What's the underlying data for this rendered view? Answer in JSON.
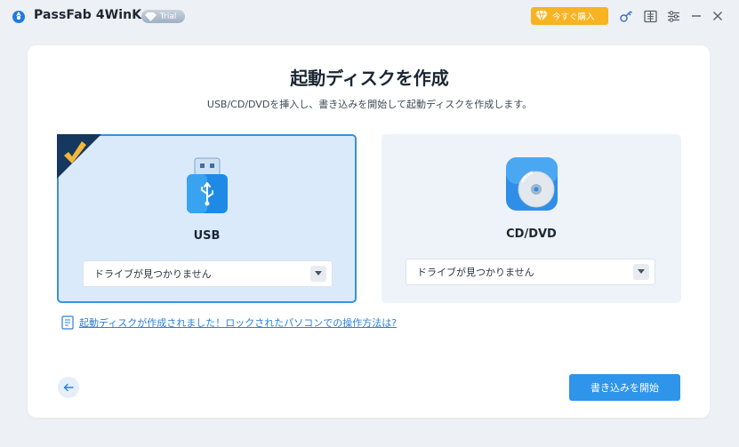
{
  "window": {
    "app_title": "PassFab 4WinKey",
    "trial_badge": "Trial",
    "buy_label": "今すぐ購入"
  },
  "main": {
    "title": "起動ディスクを作成",
    "subtitle": "USB/CD/DVDを挿入し、書き込みを開始して起動ディスクを作成します。",
    "options": [
      {
        "label": "USB",
        "dropdown_value": "ドライブが見つかりません",
        "selected": true
      },
      {
        "label": "CD/DVD",
        "dropdown_value": "ドライブが見つかりません",
        "selected": false
      }
    ],
    "help_link": "起動ディスクが作成されました！ロックされたパソコンでの操作方法は?",
    "start_button": "書き込みを開始"
  },
  "colors": {
    "accent": "#2e95ea",
    "selected_border": "#3b8fe0",
    "buy_button": "#f7b321",
    "link": "#2f7fd4"
  },
  "icons": [
    "app-logo-icon",
    "diamond-icon",
    "key-icon",
    "list-icon",
    "settings-icon",
    "minimize-icon",
    "close-icon",
    "usb-icon",
    "cd-dvd-icon",
    "checkmark-icon",
    "document-icon",
    "back-arrow-icon",
    "chevron-down-icon"
  ]
}
